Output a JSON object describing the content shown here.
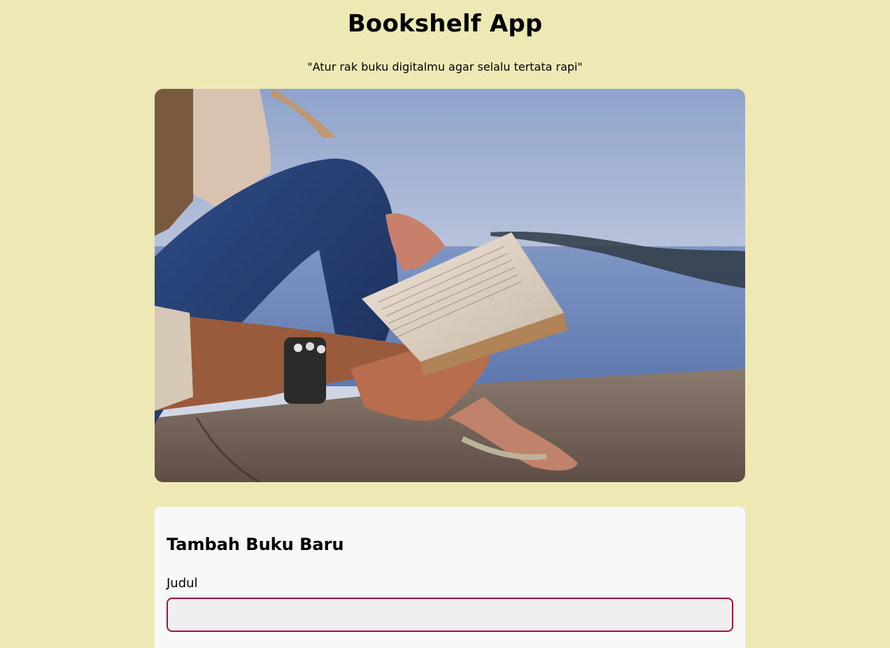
{
  "header": {
    "title": "Bookshelf App",
    "tagline": "\"Atur rak buku digitalmu agar selalu tertata rapi\""
  },
  "form": {
    "heading": "Tambah Buku Baru",
    "title_field": {
      "label": "Judul",
      "value": "",
      "placeholder": ""
    }
  },
  "colors": {
    "background": "#EEE8B5",
    "card": "#F7F8FA",
    "input_border": "#A3133B",
    "input_bg": "#EFEFEF"
  }
}
